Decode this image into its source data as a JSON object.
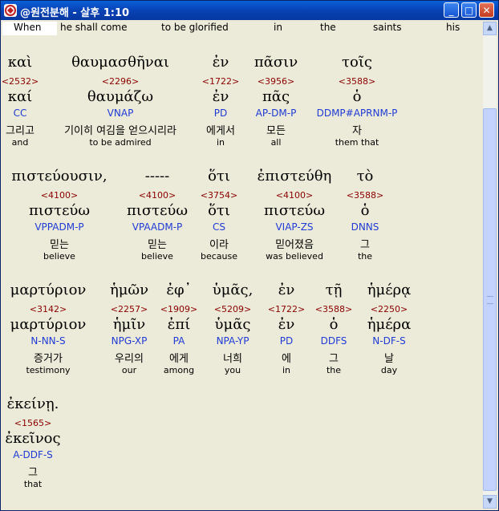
{
  "window": {
    "title": "@원전분해 - 살후 1:10"
  },
  "buttons": {
    "minimize": "_",
    "maximize": "□",
    "close": "✕"
  },
  "english_line": [
    "When",
    "he shall come",
    "to be glorified",
    "in",
    "the",
    "saints",
    "his"
  ],
  "rows": [
    {
      "words": [
        {
          "greek": "καὶ",
          "strong": "<2532>",
          "lemma": "καί",
          "parse": "CC",
          "korean": "그리고",
          "english": "and"
        },
        {
          "greek": "θαυμασθῆναι",
          "strong": "<2296>",
          "lemma": "θαυμάζω",
          "parse": "VNAP",
          "korean": "기이히 여김을 얻으시리라",
          "english": "to be admired"
        },
        {
          "greek": "ἐν",
          "strong": "<1722>",
          "lemma": "ἐν",
          "parse": "PD",
          "korean": "에게서",
          "english": "in"
        },
        {
          "greek": "πᾶσιν",
          "strong": "<3956>",
          "lemma": "πᾶς",
          "parse": "AP-DM-P",
          "korean": "모든",
          "english": "all"
        },
        {
          "greek": "τοῖς",
          "strong": "<3588>",
          "lemma": "ὁ",
          "parse": "DDMP#APRNM-P",
          "korean": "자",
          "english": "them that"
        }
      ]
    },
    {
      "words": [
        {
          "greek": "πιστεύουσιν,",
          "strong": "<4100>",
          "lemma": "πιστεύω",
          "parse": "VPPADM-P",
          "korean": "믿는",
          "english": "believe"
        },
        {
          "greek": "-----",
          "strong": "<4100>",
          "lemma": "πιστεύω",
          "parse": "VPAADM-P",
          "korean": "믿는",
          "english": "believe"
        },
        {
          "greek": "ὅτι",
          "strong": "<3754>",
          "lemma": "ὅτι",
          "parse": "CS",
          "korean": "이라",
          "english": "because"
        },
        {
          "greek": "ἐπιστεύθη",
          "strong": "<4100>",
          "lemma": "πιστεύω",
          "parse": "VIAP-ZS",
          "korean": "믿어졌음",
          "english": "was believed"
        },
        {
          "greek": "τὸ",
          "strong": "<3588>",
          "lemma": "ὁ",
          "parse": "DNNS",
          "korean": "그",
          "english": "the"
        }
      ]
    },
    {
      "words": [
        {
          "greek": "μαρτύριον",
          "strong": "<3142>",
          "lemma": "μαρτύριον",
          "parse": "N-NN-S",
          "korean": "증거가",
          "english": "testimony"
        },
        {
          "greek": "ἡμῶν",
          "strong": "<2257>",
          "lemma": "ἡμῖν",
          "parse": "NPG-XP",
          "korean": "우리의",
          "english": "our"
        },
        {
          "greek": "ἐφ᾽",
          "strong": "<1909>",
          "lemma": "ἐπί",
          "parse": "PA",
          "korean": "에게",
          "english": "among"
        },
        {
          "greek": "ὑμᾶς,",
          "strong": "<5209>",
          "lemma": "ὑμᾶς",
          "parse": "NPA-YP",
          "korean": "너희",
          "english": "you"
        },
        {
          "greek": "ἐν",
          "strong": "<1722>",
          "lemma": "ἐν",
          "parse": "PD",
          "korean": "에",
          "english": "in"
        },
        {
          "greek": "τῇ",
          "strong": "<3588>",
          "lemma": "ὁ",
          "parse": "DDFS",
          "korean": "그",
          "english": "the"
        },
        {
          "greek": "ἡμέρᾳ",
          "strong": "<2250>",
          "lemma": "ἡμέρα",
          "parse": "N-DF-S",
          "korean": "날",
          "english": "day"
        }
      ]
    },
    {
      "words": [
        {
          "greek": "ἐκείνῃ.",
          "strong": "<1565>",
          "lemma": "ἐκεῖνος",
          "parse": "A-DDF-S",
          "korean": "그",
          "english": "that"
        }
      ]
    }
  ]
}
